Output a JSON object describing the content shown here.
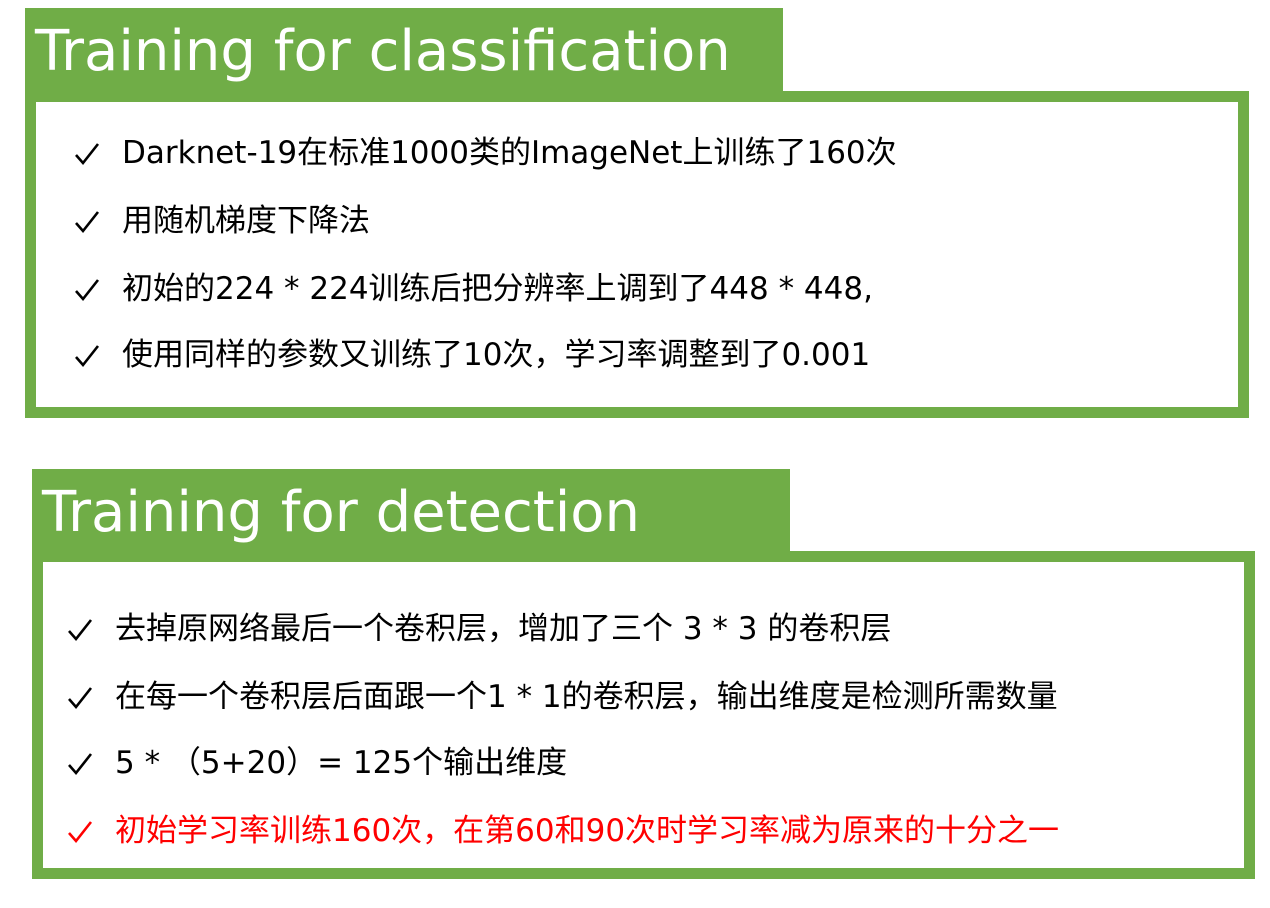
{
  "classification": {
    "title": "Training for classification",
    "items": [
      {
        "text": "Darknet-19在标准1000类的ImageNet上训练了160次"
      },
      {
        "text": "用随机梯度下降法"
      },
      {
        "text": "初始的224 * 224训练后把分辨率上调到了448 * 448,"
      },
      {
        "text": "使用同样的参数又训练了10次，学习率调整到了0.001"
      }
    ]
  },
  "detection": {
    "title": "Training for detection",
    "items": [
      {
        "text": "去掉原网络最后一个卷积层，增加了三个 3 * 3 的卷积层"
      },
      {
        "text": "在每一个卷积层后面跟一个1 * 1的卷积层，输出维度是检测所需数量"
      },
      {
        "text": "5 * （5+20）= 125个输出维度"
      },
      {
        "text": "初始学习率训练160次，在第60和90次时学习率减为原来的十分之一",
        "highlight": true
      }
    ]
  },
  "colors": {
    "accent": "#70ad47",
    "title_text": "#ffffff",
    "body_text": "#000000",
    "highlight_text": "#ff0000"
  },
  "icons": {
    "bullet": "check-icon"
  }
}
